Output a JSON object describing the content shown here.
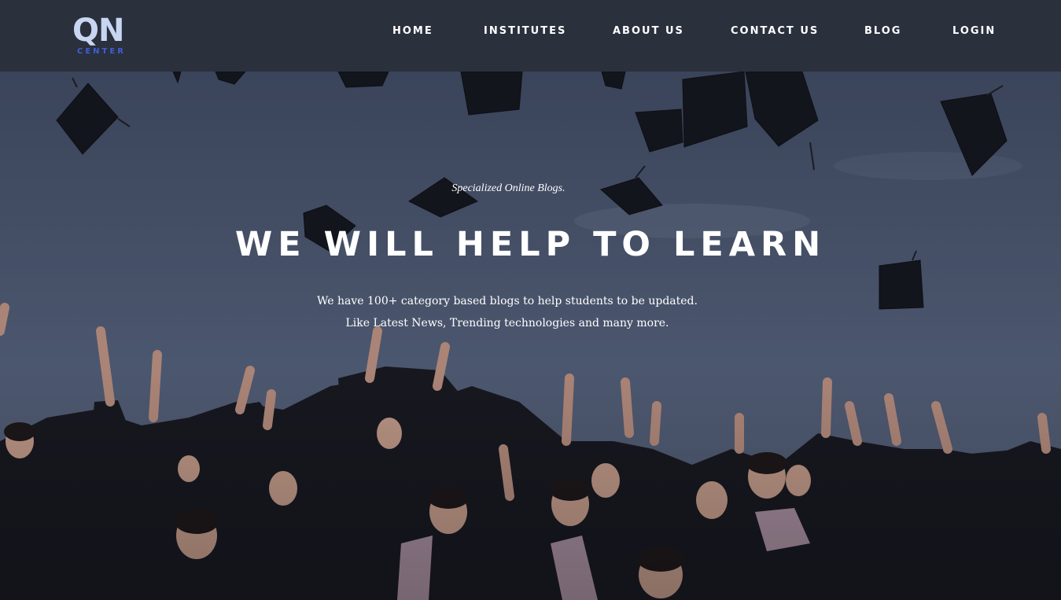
{
  "brand": {
    "logo_main": "QN",
    "logo_sub": "CENTER"
  },
  "nav": {
    "home": "HOME",
    "institutes": "INSTITUTES",
    "about": "ABOUT US",
    "contact": "CONTACT US",
    "blog": "BLOG",
    "login": "LOGIN"
  },
  "hero": {
    "tagline": "Specialized Online Blogs.",
    "headline": "WE WILL HELP TO LEARN",
    "description_line1": "We have 100+ category based blogs to help students to be updated.",
    "description_line2": "Like Latest News, Trending technologies and many more."
  },
  "colors": {
    "navbar_bg": "#2b303d",
    "logo_text": "#c9d6f2",
    "logo_accent": "#3f5fd6",
    "hero_text": "#ffffff"
  }
}
